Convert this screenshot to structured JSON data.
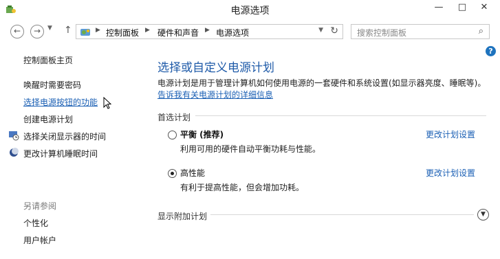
{
  "window": {
    "title": "电源选项",
    "minimize": "—",
    "close": "✕"
  },
  "nav": {
    "breadcrumb": [
      "控制面板",
      "硬件和声音",
      "电源选项"
    ],
    "search_placeholder": "搜索控制面板"
  },
  "sidebar": {
    "home": "控制面板主页",
    "items": [
      "唤醒时需要密码",
      "选择电源按钮的功能",
      "创建电源计划",
      "选择关闭显示器的时间",
      "更改计算机睡眠时间"
    ],
    "see_also": "另请参阅",
    "see_also_items": [
      "个性化",
      "用户帐户"
    ]
  },
  "main": {
    "title": "选择或自定义电源计划",
    "description": "电源计划是用于管理计算机如何使用电源的一套硬件和系统设置(如显示器亮度、睡眠等)。",
    "info_link": "告诉我有关电源计划的详细信息",
    "preferred_label": "首选计划",
    "plans": [
      {
        "name": "平衡 (推荐)",
        "desc": "利用可用的硬件自动平衡功耗与性能。",
        "link": "更改计划设置",
        "selected": false
      },
      {
        "name": "高性能",
        "desc": "有利于提高性能，但会增加功耗。",
        "link": "更改计划设置",
        "selected": true
      }
    ],
    "extra_plans": "显示附加计划"
  },
  "colors": {
    "accent": "#1e5aa8",
    "link": "#1a5fb4"
  }
}
